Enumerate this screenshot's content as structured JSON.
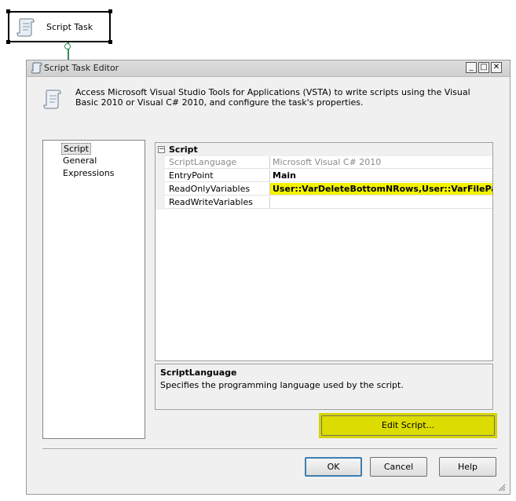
{
  "node": {
    "label": "Script Task",
    "icon": "script-scroll-icon"
  },
  "dialog": {
    "title": "Script Task Editor",
    "description": "Access Microsoft Visual Studio Tools for Applications (VSTA) to write scripts using the Visual Basic 2010 or Visual C# 2010, and configure the task's properties.",
    "window_controls": {
      "minimize": "_",
      "maximize": "□",
      "close": "✕"
    }
  },
  "nav": {
    "items": [
      {
        "label": "Script",
        "selected": true
      },
      {
        "label": "General",
        "selected": false
      },
      {
        "label": "Expressions",
        "selected": false
      }
    ]
  },
  "grid": {
    "category": "Script",
    "toggle": "−",
    "rows": [
      {
        "name": "ScriptLanguage",
        "value": "Microsoft Visual C# 2010"
      },
      {
        "name": "EntryPoint",
        "value": "Main"
      },
      {
        "name": "ReadOnlyVariables",
        "value": "User::VarDeleteBottomNRows,User::VarFilePath"
      },
      {
        "name": "ReadWriteVariables",
        "value": ""
      }
    ]
  },
  "help": {
    "title": "ScriptLanguage",
    "description": "Specifies the programming language used by the script."
  },
  "buttons": {
    "edit_script": "Edit Script...",
    "ok": "OK",
    "cancel": "Cancel",
    "help": "Help"
  },
  "colors": {
    "highlight": "#f3f300",
    "edit_script_highlight": "#d4d400",
    "connector": "#2e8b57"
  }
}
